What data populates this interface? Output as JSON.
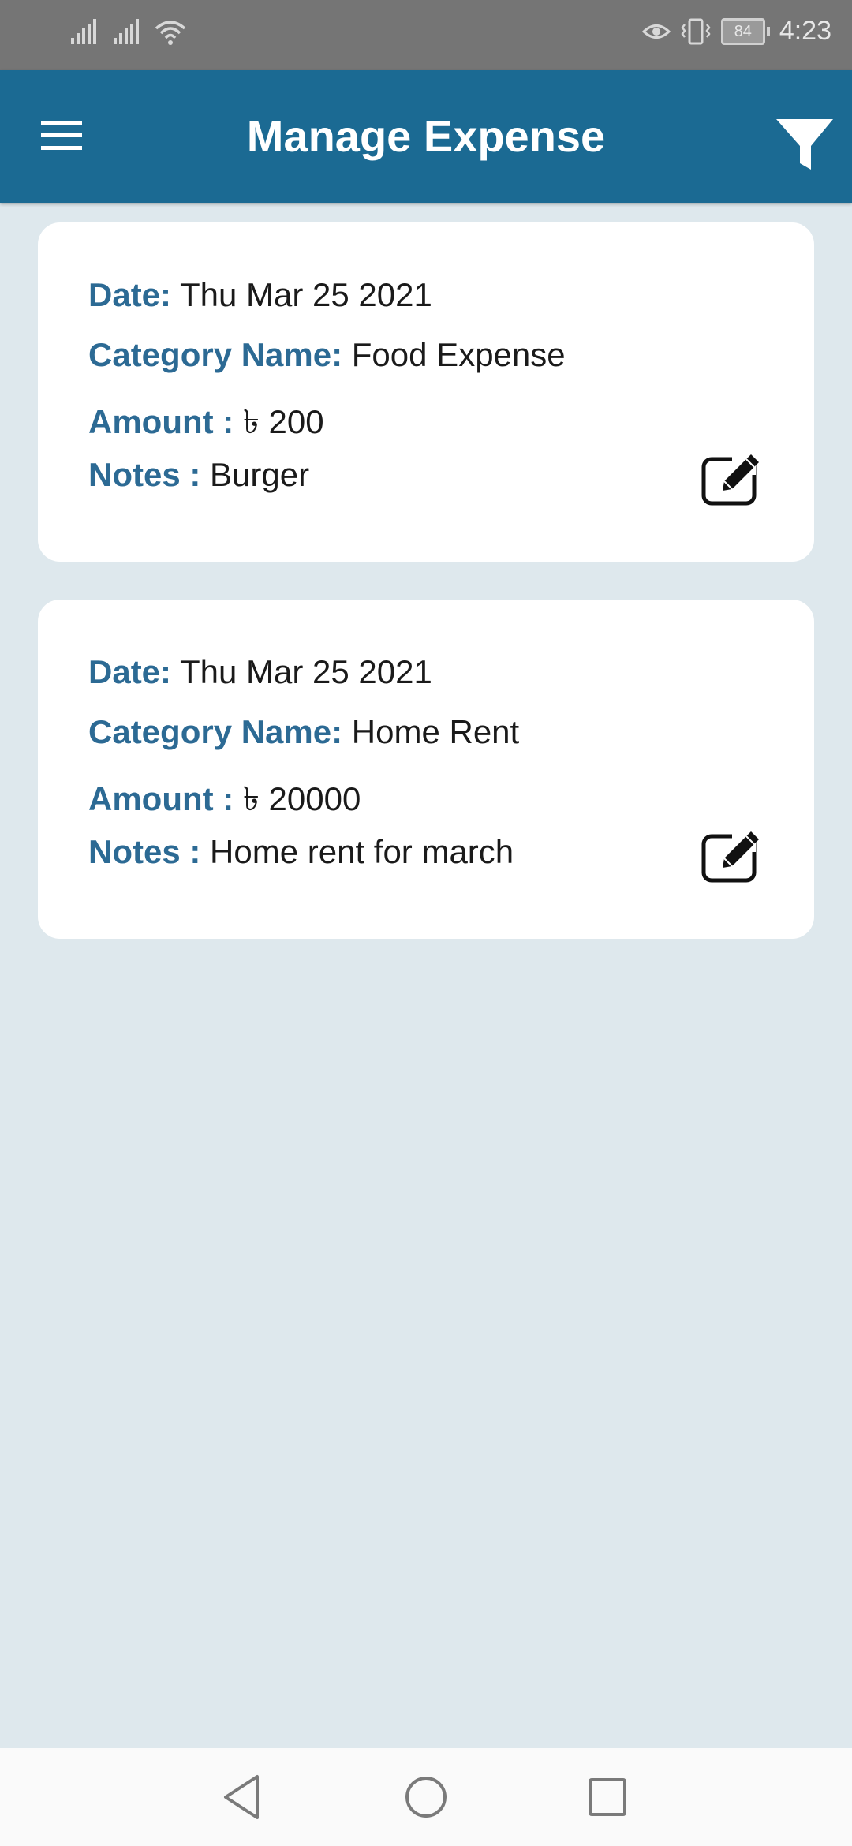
{
  "status_bar": {
    "battery": "84",
    "time": "4:23"
  },
  "app_bar": {
    "title": "Manage Expense",
    "menu_icon": "hamburger-menu-icon",
    "filter_icon": "filter-funnel-icon"
  },
  "colors": {
    "app_bar": "#1b6a93",
    "label": "#2c6a94",
    "background": "#dee8ed",
    "card": "#ffffff"
  },
  "labels": {
    "date": "Date:",
    "category": "Category Name:",
    "amount": "Amount :",
    "notes": "Notes :"
  },
  "expenses": [
    {
      "date": "Thu Mar 25 2021",
      "category": "Food Expense",
      "amount": "৳ 200",
      "notes": "Burger"
    },
    {
      "date": "Thu Mar 25 2021",
      "category": "Home Rent",
      "amount": "৳ 20000",
      "notes": "Home rent for march"
    }
  ],
  "nav": {
    "back_icon": "back-triangle-icon",
    "home_icon": "home-circle-icon",
    "recents_icon": "recents-square-icon"
  }
}
